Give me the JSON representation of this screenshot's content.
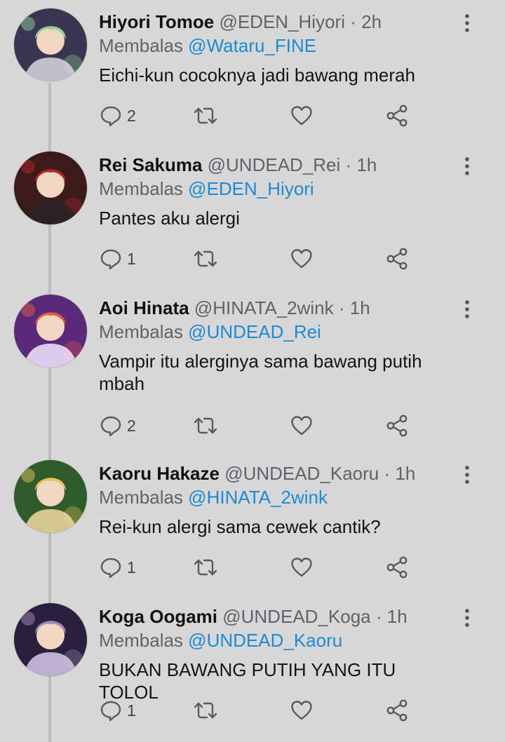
{
  "reply_prefix": "Membalas",
  "dot": "·",
  "tweets": [
    {
      "name": "Hiyori Tomoe",
      "handle": "@EDEN_Hiyori",
      "time": "2h",
      "reply_to": "@Wataru_FINE",
      "text": "Eichi-kun cocoknya jadi bawang merah",
      "reply_count": "2",
      "avatar_colors": [
        "#3a3550",
        "#8fd19e",
        "#d9d6e2"
      ]
    },
    {
      "name": "Rei Sakuma",
      "handle": "@UNDEAD_Rei",
      "time": "1h",
      "reply_to": "@EDEN_Hiyori",
      "text": "Pantes aku alergi",
      "reply_count": "1",
      "avatar_colors": [
        "#3b1a1a",
        "#b3262e",
        "#2a2222"
      ]
    },
    {
      "name": "Aoi Hinata",
      "handle": "@HINATA_2wink",
      "time": "1h",
      "reply_to": "@UNDEAD_Rei",
      "text": "Vampir itu alerginya sama bawang putih mbah",
      "reply_count": "2",
      "avatar_colors": [
        "#5a2a78",
        "#e0574a",
        "#f3e7ff"
      ]
    },
    {
      "name": "Kaoru Hakaze",
      "handle": "@UNDEAD_Kaoru",
      "time": "1h",
      "reply_to": "@HINATA_2wink",
      "text": "Rei-kun alergi sama cewek cantik?",
      "reply_count": "1",
      "avatar_colors": [
        "#2f5a2a",
        "#e8c25a",
        "#f1d9a0"
      ]
    },
    {
      "name": "Koga Oogami",
      "handle": "@UNDEAD_Koga",
      "time": "1h",
      "reply_to": "@UNDEAD_Kaoru",
      "text": "BUKAN BAWANG PUTIH YANG ITU TOLOL",
      "reply_count": "1",
      "avatar_colors": [
        "#2a1f3d",
        "#9c8bb8",
        "#d7c9ea"
      ]
    }
  ],
  "colors": {
    "background": "#d7d7d7",
    "mention": "#1d8ad6",
    "muted": "#5f6368",
    "icon": "#5a5a5a"
  },
  "icons": [
    "reply-icon",
    "retweet-icon",
    "like-icon",
    "share-icon",
    "more-icon"
  ]
}
